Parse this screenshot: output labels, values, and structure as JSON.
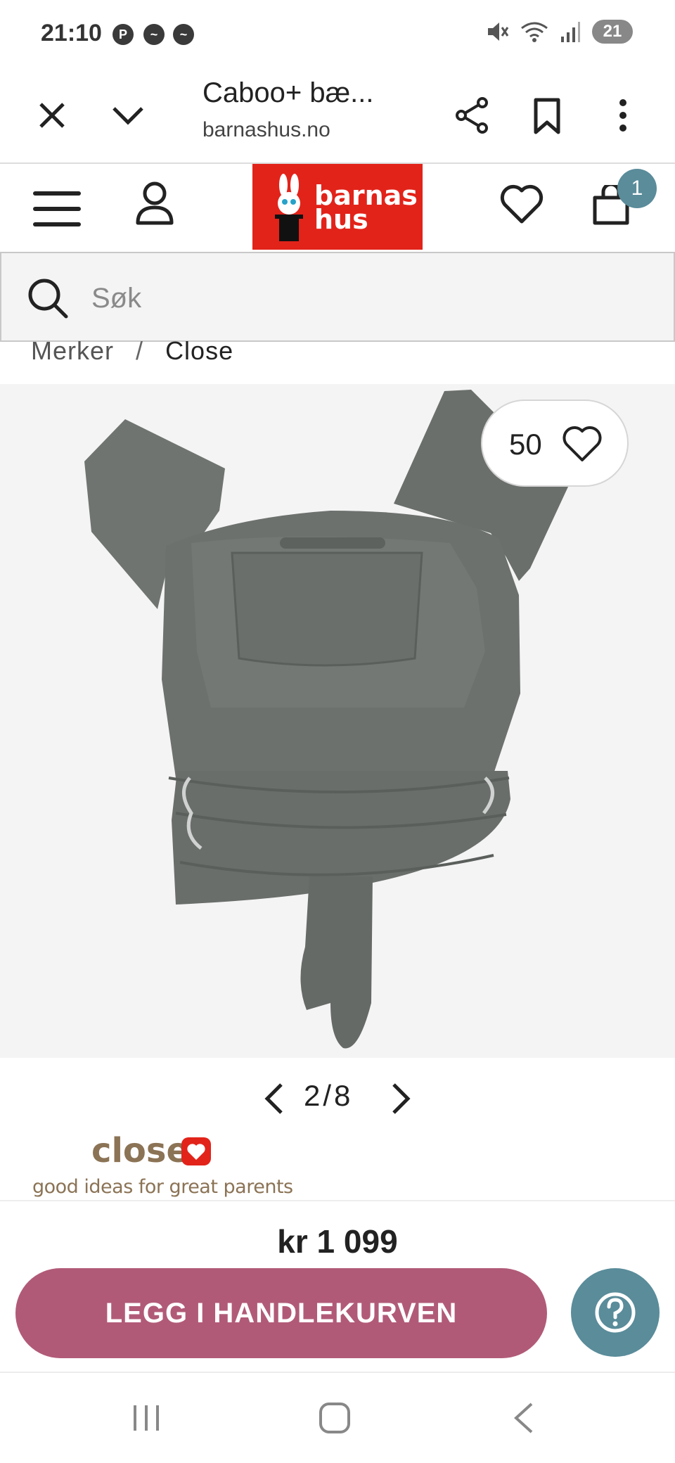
{
  "status": {
    "time": "21:10",
    "battery": "21",
    "notification_icons": [
      "pinterest-icon",
      "messenger-icon",
      "messenger-icon"
    ],
    "system_icons": [
      "mute-icon",
      "wifi-icon",
      "signal-icon"
    ]
  },
  "browser": {
    "page_title": "Caboo+ bæ...",
    "domain": "barnashus.no"
  },
  "site": {
    "logo_text_line1": "barnas",
    "logo_text_line2": "hus",
    "cart_count": "1",
    "brand_color": "#e2231a"
  },
  "search": {
    "placeholder": "Søk"
  },
  "breadcrumb": {
    "items": [
      "Merker",
      "Close"
    ],
    "separator": "/"
  },
  "product": {
    "favorite_count": "50",
    "image_index": "2",
    "image_total": "8",
    "pager_separator": "/",
    "brand_name": "close",
    "brand_tagline": "good ideas for great parents",
    "price": "kr 1 099",
    "add_to_cart_label": "LEGG I HANDLEKURVEN",
    "add_to_cart_color": "#b15a78",
    "help_color": "#5a8c9a"
  },
  "navbar": {
    "icons": [
      "recent-apps-icon",
      "home-icon",
      "back-icon"
    ]
  }
}
